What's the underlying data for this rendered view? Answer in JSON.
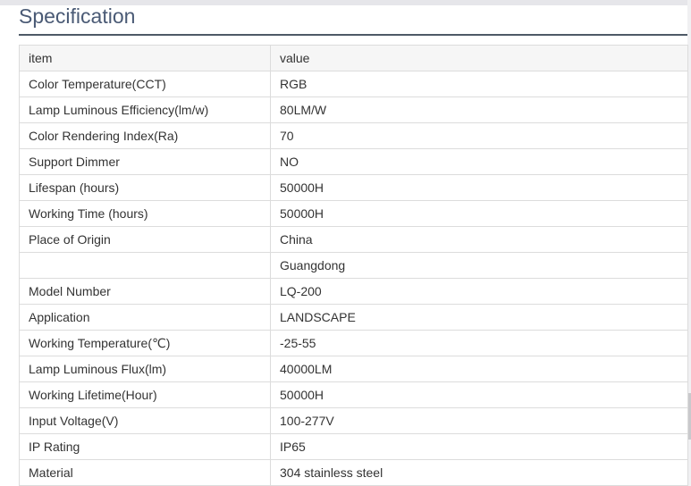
{
  "section": {
    "title": "Specification"
  },
  "table": {
    "header": {
      "item": "item",
      "value": "value"
    },
    "rows": [
      {
        "item": "Color Temperature(CCT)",
        "value": "RGB"
      },
      {
        "item": "Lamp Luminous Efficiency(lm/w)",
        "value": "80LM/W"
      },
      {
        "item": "Color Rendering Index(Ra)",
        "value": "70"
      },
      {
        "item": "Support Dimmer",
        "value": "NO"
      },
      {
        "item": "Lifespan (hours)",
        "value": "50000H"
      },
      {
        "item": "Working Time (hours)",
        "value": "50000H"
      },
      {
        "item": "Place of Origin",
        "value": "China"
      },
      {
        "item": "",
        "value": "Guangdong"
      },
      {
        "item": "Model Number",
        "value": "LQ-200"
      },
      {
        "item": "Application",
        "value": "LANDSCAPE"
      },
      {
        "item": "Working Temperature(℃)",
        "value": "-25-55"
      },
      {
        "item": "Lamp Luminous Flux(lm)",
        "value": "40000LM"
      },
      {
        "item": "Working Lifetime(Hour)",
        "value": "50000H"
      },
      {
        "item": "Input Voltage(V)",
        "value": "100-277V"
      },
      {
        "item": "IP Rating",
        "value": "IP65"
      },
      {
        "item": "Material",
        "value": "304 stainless steel"
      }
    ]
  }
}
